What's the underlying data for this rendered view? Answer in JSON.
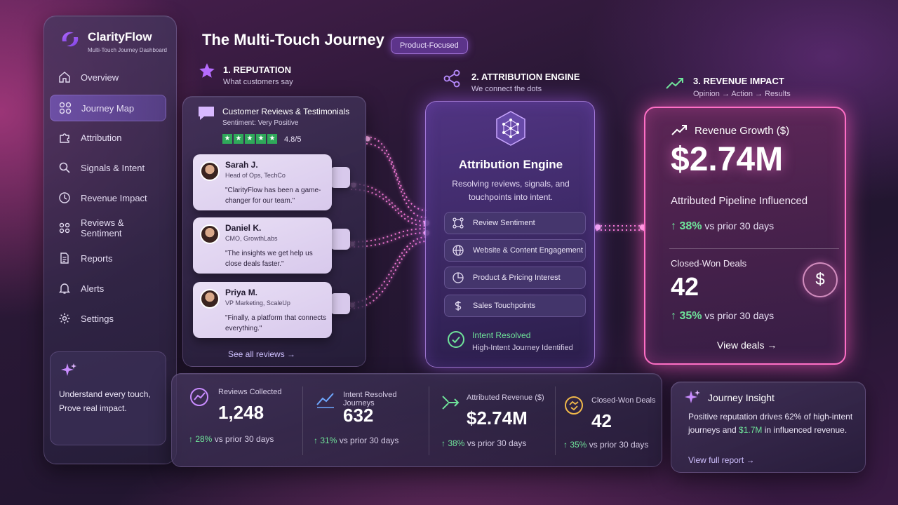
{
  "brand": {
    "name": "ClarityFlow",
    "subtitle": "Multi-Touch Journey Dashboard"
  },
  "sidebar": {
    "items": [
      {
        "label": "Overview",
        "icon": "home-icon"
      },
      {
        "label": "Journey Map",
        "icon": "grid-icon",
        "active": true
      },
      {
        "label": "Attribution",
        "icon": "puzzle-icon"
      },
      {
        "label": "Signals & Intent",
        "icon": "search-icon"
      },
      {
        "label": "Revenue Impact",
        "icon": "clock-icon"
      },
      {
        "label": "Reviews & Sentiment",
        "icon": "users-icon"
      },
      {
        "label": "Reports",
        "icon": "document-icon"
      },
      {
        "label": "Alerts",
        "icon": "bell-icon"
      },
      {
        "label": "Settings",
        "icon": "gear-icon"
      }
    ],
    "card_text": "Understand every touch, Prove real impact."
  },
  "header": {
    "title": "The Multi-Touch Journey",
    "badge": "Product-Focused"
  },
  "sections": {
    "reputation": {
      "title": "1. REPUTATION",
      "subtitle": "What customers say"
    },
    "attribution": {
      "title": "2. ATTRIBUTION ENGINE",
      "subtitle": "We connect the dots"
    },
    "revenue": {
      "title": "3. REVENUE IMPACT",
      "subtitle": "Opinion → Action → Results"
    }
  },
  "reviews": {
    "title": "Customer Reviews & Testimonials",
    "sentiment": "Sentiment: Very Positive",
    "rating": "4.8/5",
    "items": [
      {
        "name": "Sarah J.",
        "role": "Head of Ops, TechCo",
        "quote": "\"ClarityFlow has been a game-changer for our team.\""
      },
      {
        "name": "Daniel K.",
        "role": "CMO, GrowthLabs",
        "quote": "\"The insights we get help us close deals faster.\""
      },
      {
        "name": "Priya M.",
        "role": "VP Marketing, ScaleUp",
        "quote": "\"Finally, a platform that connects everything.\""
      }
    ],
    "see_all": "See all reviews →"
  },
  "engine": {
    "title": "Attribution Engine",
    "subtitle": "Resolving reviews, signals, and touchpoints into intent.",
    "rows": [
      {
        "label": "Review Sentiment",
        "icon": "nodes-icon"
      },
      {
        "label": "Website & Content Engagement",
        "icon": "globe-icon"
      },
      {
        "label": "Product & Pricing Interest",
        "icon": "pie-icon"
      },
      {
        "label": "Sales Touchpoints",
        "icon": "dollar-icon"
      }
    ],
    "status": "Intent Resolved",
    "status_sub": "High-Intent Journey Identified"
  },
  "revenue": {
    "title": "Revenue Growth ($)",
    "value": "$2.74M",
    "label": "Attributed Pipeline Influenced",
    "delta": "↑ 38%",
    "delta_text": "vs prior 30 days",
    "closed_label": "Closed-Won Deals",
    "closed_value": "42",
    "closed_delta": "↑ 35%",
    "closed_delta_text": "vs prior 30 days",
    "cta": "View deals →"
  },
  "stats": [
    {
      "label": "Reviews Collected",
      "value": "1,248",
      "delta": "↑ 28%",
      "delta_text": "vs prior 30 days",
      "icon": "reviews-chart-icon"
    },
    {
      "label": "Intent Resolved Journeys",
      "value": "632",
      "delta": "↑ 31%",
      "delta_text": "vs prior 30 days",
      "icon": "trend-icon"
    },
    {
      "label": "Attributed Revenue ($)",
      "value": "$2.74M",
      "delta": "↑ 38%",
      "delta_text": "vs prior 30 days",
      "icon": "sparkle-arrow-icon"
    },
    {
      "label": "Closed-Won Deals",
      "value": "42",
      "delta": "↑ 35%",
      "delta_text": "vs prior 30 days",
      "icon": "handshake-icon"
    }
  ],
  "insight": {
    "title": "Journey Insight",
    "text_1": "Positive reputation drives ",
    "pct": "62%",
    "text_2": " of high-intent journeys and ",
    "amount": "$1.7M",
    "text_3": " in influenced revenue.",
    "link": "View full report →"
  },
  "colors": {
    "accent": "#b77cff",
    "positive": "#6fe39a",
    "glow_pink": "#ff6fc6"
  }
}
